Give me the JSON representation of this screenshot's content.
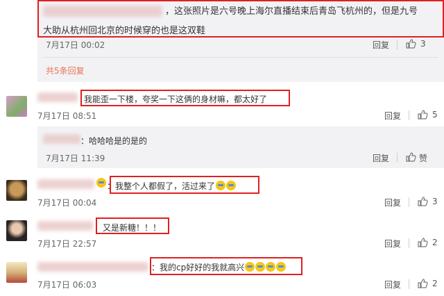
{
  "top_reply": {
    "text_line1": "，这张照片是六号晚上海尔直播结束后青岛飞杭州的，但是九号",
    "text_line2": "大助从杭州回北京的时候穿的也是这双鞋",
    "time": "7月17日 00:02",
    "reply_label": "回复",
    "like_count": "3",
    "more_link": "共5条回复"
  },
  "comments": [
    {
      "text": "我能歪一下楼，夸奖一下这俩的身材嘛，都太好了",
      "time": "7月17日 08:51",
      "reply_label": "回复",
      "like_count": "5",
      "sub": {
        "text": "：哈哈哈是的是的",
        "time": "7月17日 11:39",
        "reply_label": "回复",
        "like_label": "赞"
      }
    },
    {
      "text": "：我整个人都假了，活过来了",
      "time": "7月17日 00:04",
      "reply_label": "回复",
      "like_count": "3"
    },
    {
      "text": "：又是新糖！！！",
      "time": "7月17日 22:57",
      "reply_label": "回复",
      "like_count": "2"
    },
    {
      "text": "：我的cp好好的我就高兴",
      "time": "7月17日 06:03",
      "reply_label": "回复",
      "like_count": "2"
    }
  ],
  "colors": {
    "highlight": "#e02020",
    "link": "#eb7350",
    "panel": "#f2f2f5"
  }
}
